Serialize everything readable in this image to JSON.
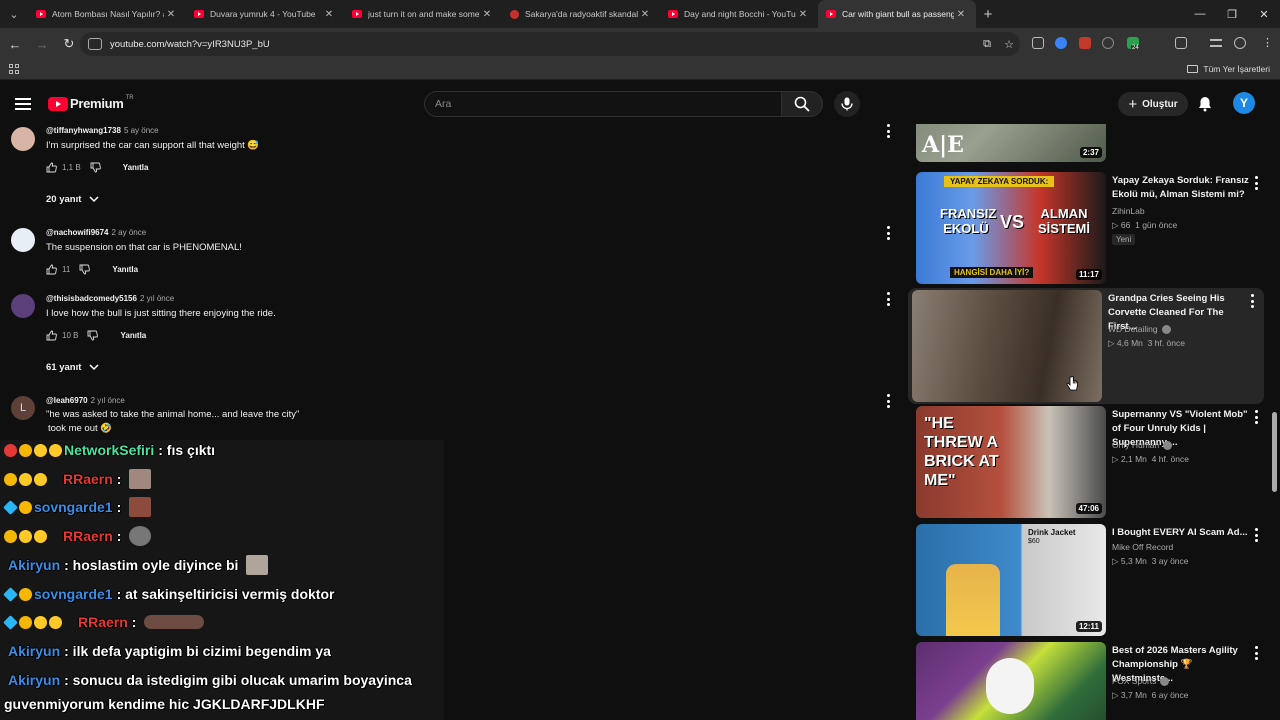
{
  "browser": {
    "tabs": [
      {
        "title": "Atom Bombası Nasıl Yapılır? #s"
      },
      {
        "title": "Duvara yumruk 4 - YouTube"
      },
      {
        "title": "just turn it on and make someti"
      },
      {
        "title": "Sakarya'da radyoaktif skandal!"
      },
      {
        "title": "Day and night Bocchi - YouTube"
      },
      {
        "title": "Car with giant bull as passenge"
      }
    ],
    "url": "youtube.com/watch?v=yIR3NU3P_bU",
    "bookmarks_all": "Tüm Yer İşaretleri",
    "extension_badge": "24"
  },
  "header": {
    "brand": "Premium",
    "country": "TR",
    "search_placeholder": "Ara",
    "create_label": "Oluştur",
    "avatar_letter": "Y"
  },
  "comments": [
    {
      "author": "@tiffanyhwang1738",
      "time": "5 ay önce",
      "text": "I'm surprised the car can support all that weight 😅",
      "likes": "1,1 B",
      "reply_label": "Yanıtla",
      "replies": "20 yanıt"
    },
    {
      "author": "@nachowifi9674",
      "time": "2 ay önce",
      "text": "The suspension on that car is PHENOMENAL!",
      "likes": "11",
      "reply_label": "Yanıtla"
    },
    {
      "author": "@thisisbadcomedy5156",
      "time": "2 yıl önce",
      "text": "I love how the bull is just sitting there enjoying the ride.",
      "likes": "10 B",
      "reply_label": "Yanıtla",
      "replies": "61 yanıt"
    },
    {
      "author": "@leah6970",
      "time": "2 yıl önce",
      "text": "\"he was asked to take the animal home... and leave the city\"",
      "text2": "took me out 🤣",
      "avatar_letter": "L"
    }
  ],
  "chat": [
    {
      "nick": "NetworkSefiri",
      "message": ": fıs çıktı"
    },
    {
      "nick": "RRaern",
      "message": ":"
    },
    {
      "nick": "sovngarde1",
      "message": ":"
    },
    {
      "nick": "RRaern",
      "message": ":"
    },
    {
      "nick": "Akiryun",
      "message": ": hoslastim oyle diyince bi"
    },
    {
      "nick": "sovngarde1",
      "message": ": at sakinşeltiricisi vermiş doktor"
    },
    {
      "nick": "RRaern",
      "message": ":"
    },
    {
      "nick": "Akiryun",
      "message": ": ilk defa yaptigim bi cizimi begendim ya"
    },
    {
      "nick": "Akiryun",
      "message": ": sonucu da istedigim gibi olucak umarim boyayinca"
    },
    {
      "nick": "",
      "message": "guvenmiyorum kendime hic JGKLDARFJDLKHF"
    }
  ],
  "recommendations": [
    {
      "duration": "2:37"
    },
    {
      "title": "Yapay Zekaya Sorduk: Fransız Ekolü mü, Alman Sistemi mi?",
      "channel": "ZihinLab",
      "views": "66",
      "age": "1 gün önce",
      "badge": "Yeni",
      "duration": "11:17",
      "thumb_text_top": "YAPAY ZEKAYA SORDUK:",
      "thumb_text_a": "FRANSIZ EKOLÜ",
      "thumb_text_vs": "VS",
      "thumb_text_b": "ALMAN SİSTEMİ",
      "thumb_text_bottom": "HANGİSİ DAHA İYİ?"
    },
    {
      "title": "Grandpa Cries Seeing His Corvette Cleaned For The First...",
      "channel": "WD Detailing",
      "views": "4,6 Mn",
      "age": "3 hf. önce",
      "duration": ""
    },
    {
      "title": "Supernanny VS \"Violent Mob\" of Four Unruly Kids | Supernanny ...",
      "channel": "Only Human",
      "views": "2,1 Mn",
      "age": "4 hf. önce",
      "duration": "47:06",
      "thumb_text": "\"HE THREW A BRICK AT ME\""
    },
    {
      "title": "I Bought EVERY AI Scam Ad...",
      "channel": "Mike Off Record",
      "views": "5,3 Mn",
      "age": "3 ay önce",
      "duration": "12:11",
      "thumb_text": "Drink Jacket",
      "thumb_price": "$60"
    },
    {
      "title": "Best of 2026 Masters Agility Championship 🏆 Westminste...",
      "channel": "FOX Sports",
      "views": "3,7 Mn",
      "age": "6 ay önce",
      "duration": ""
    }
  ],
  "colors": {
    "yt_red": "#ff0033",
    "bg": "#0f0f0f",
    "accent_blue": "#1e88e5"
  }
}
